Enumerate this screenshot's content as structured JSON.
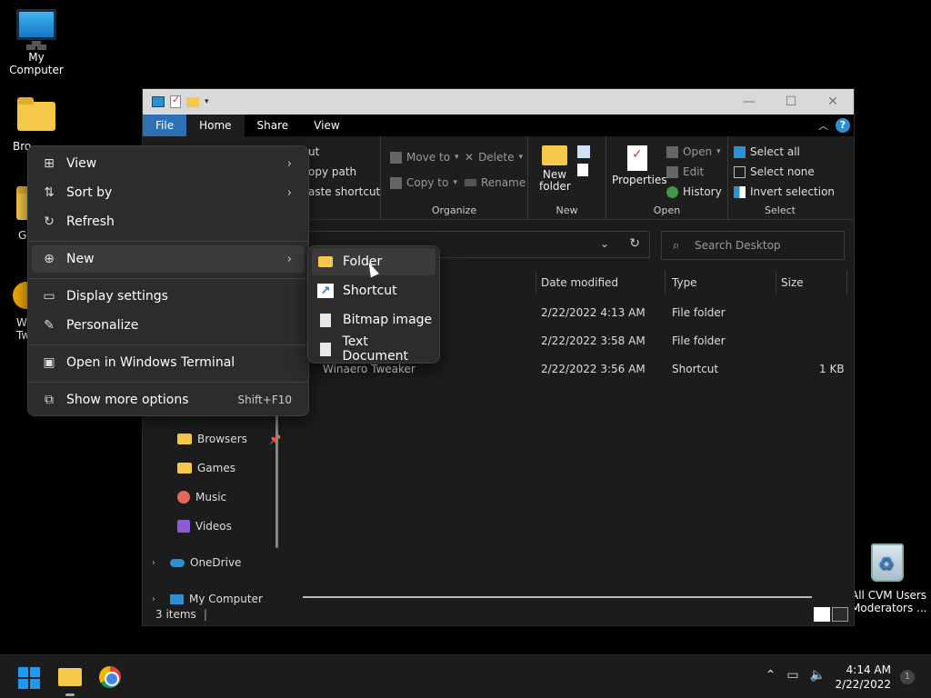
{
  "desktop": {
    "my_computer": "My Computer",
    "browsers_partial": "Bro",
    "games_partial": "G",
    "tweaker_partial_1": "W",
    "tweaker_partial_2": "Tw",
    "recycle_line1": "All CVM Users",
    "recycle_line2": "Moderators ..."
  },
  "tabs": {
    "file": "File",
    "home": "Home",
    "share": "Share",
    "view": "View"
  },
  "ribbon": {
    "cut": "ut",
    "copy_path": "opy path",
    "paste_shortcut": "aste shortcut",
    "move_to": "Move to",
    "copy_to": "Copy to",
    "delete": "Delete",
    "rename": "Rename",
    "organize": "Organize",
    "new_folder_l1": "New",
    "new_folder_l2": "folder",
    "new_group": "New",
    "properties": "Properties",
    "open": "Open",
    "edit": "Edit",
    "history": "History",
    "open_group": "Open",
    "select_all": "Select all",
    "select_none": "Select none",
    "invert_selection": "Invert selection",
    "select_group": "Select"
  },
  "address": {
    "search_placeholder": "Search Desktop"
  },
  "columns": {
    "date": "Date modified",
    "type": "Type",
    "size": "Size"
  },
  "files": [
    {
      "name": "",
      "date": "2/22/2022 4:13 AM",
      "type": "File folder",
      "size": ""
    },
    {
      "name": "",
      "date": "2/22/2022 3:58 AM",
      "type": "File folder",
      "size": ""
    },
    {
      "name": "Winaero Tweaker",
      "date": "2/22/2022 3:56 AM",
      "type": "Shortcut",
      "size": "1 KB"
    }
  ],
  "nav": {
    "browsers": "Browsers",
    "games": "Games",
    "music": "Music",
    "videos": "Videos",
    "onedrive": "OneDrive",
    "my_computer": "My Computer"
  },
  "status": {
    "items": "3 items"
  },
  "context_menu": {
    "view": "View",
    "sort_by": "Sort by",
    "refresh": "Refresh",
    "new": "New",
    "display_settings": "Display settings",
    "personalize": "Personalize",
    "open_terminal": "Open in Windows Terminal",
    "show_more": "Show more options",
    "show_more_kbd": "Shift+F10"
  },
  "submenu": {
    "folder": "Folder",
    "shortcut": "Shortcut",
    "bitmap": "Bitmap image",
    "text_doc": "Text Document"
  },
  "taskbar": {
    "time": "4:14 AM",
    "date": "2/22/2022"
  }
}
